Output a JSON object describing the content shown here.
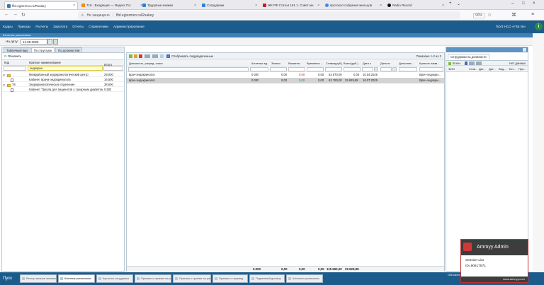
{
  "browser": {
    "tabs": [
      {
        "label": "ffid.egiszmso.ru/Rsalary",
        "color": "#3a6fb0",
        "active": true
      },
      {
        "label": "718 · Входящие — Яндекс По:",
        "color": "#f08a1c"
      },
      {
        "label": "Трудовые книжки",
        "color": "#2b82d9"
      },
      {
        "label": "Сотрудники",
        "color": "#2b82d9"
      },
      {
        "label": "ЖК РФ Статья 161.1. Совет мн",
        "color": "#c52020"
      },
      {
        "label": "протокол собрания жильцов",
        "color": "#4285f4"
      },
      {
        "label": "Radio Record",
        "color": "#111111"
      }
    ],
    "insecure": "Не защищено",
    "url": "ffid.egiszmso.ru/Rsalary",
    "zoom": "90%"
  },
  "app": {
    "menu": [
      "Кадры",
      "Приказы",
      "Расчеты",
      "Зарплата",
      "Отчеты",
      "Справочники",
      "Администрирование"
    ],
    "org": "ГБУЗ НСО «ГКБ №»",
    "info": "i",
    "window_title": "Штатные расписания",
    "date_label": "На дату:",
    "date_value": "14.08.2025"
  },
  "left": {
    "tabs": [
      "Табличный вид",
      "По структуре",
      "По должностям"
    ],
    "refresh": "Обновить",
    "headers": {
      "code": "Код",
      "name": "Краткое наименование",
      "total": "Итого"
    },
    "filter_value": "эндокрин",
    "rows": [
      {
        "code": "",
        "name": "Межрайонный эндокринологический центр",
        "total": "29.000",
        "type": "folder"
      },
      {
        "code": "",
        "name": "Кабинет врача-эндокринолога",
        "total": "16.500",
        "type": "doc"
      },
      {
        "code": "78",
        "name": "Эндокринологическое отделение",
        "total": "38.500",
        "type": "folder"
      },
      {
        "code": "",
        "name": "Кабинет \"Школа для пациентов с сахарным диабетом\"",
        "total": "0.500",
        "type": "doc"
      }
    ]
  },
  "center": {
    "show_sub": "Отображать подразделенные",
    "paging": "Показано 1-2 из 2",
    "headers": [
      "Должность, разряд, класс",
      "Штатных ед.",
      "Занято",
      "Вакантно",
      "Временно ...",
      "Ставка(руб.)",
      "Всего(руб.)",
      "Дата с",
      "Дата по",
      "Дополнит...",
      "Краткое наим..."
    ],
    "rows": [
      {
        "post": "врач-эндокринолог",
        "units": "0.000",
        "busy": "0,00",
        "vac": "0,00",
        "temp": "0,00",
        "rate": "52 870,00",
        "total": "0,00",
        "from": "10.04.2025",
        "to": "",
        "add": "",
        "short": "Врач-эндокри..."
      },
      {
        "post": "врач-эндокринолог",
        "units": "0.000",
        "busy": "0,00",
        "vac": "0,00",
        "temp": "0,00",
        "rate": "62 790,00",
        "total": "29 629,88",
        "from": "16.07.2025",
        "to": "",
        "add": "",
        "short": "Врач-эндокри..."
      }
    ],
    "totals": {
      "units": "0.000",
      "busy": "0,00",
      "vac": "0,00",
      "temp": "0,00",
      "rate": "115 650,00",
      "total": "29 629,88"
    }
  },
  "right": {
    "tab": "Сотрудники на должности",
    "tool": "В нач",
    "nodata": "Нет данных",
    "headers": [
      "ФИО",
      "Став...",
      "Дат...",
      "Дат...",
      "Вид...",
      "Тип...",
      "При..."
    ]
  },
  "taskbar": {
    "start": "Пуск",
    "buttons": [
      "Реестр заказов запланир...",
      "Штатные расписания",
      "Карточка сотрудника",
      "Приказы о приеме на ра...",
      "Приказы о приеме на работу",
      "Приказы о перевод",
      "Подменный договор",
      "Штатные расписания"
    ],
    "right": "Обновлено"
  },
  "ammyy": {
    "title": "Ammyy Admin",
    "session": "Session List",
    "id": "ID=90617871",
    "site": "www.ammyy.com"
  }
}
